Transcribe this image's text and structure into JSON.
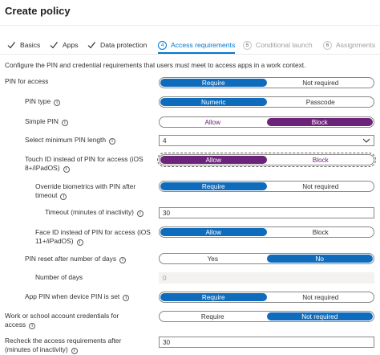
{
  "page": {
    "title": "Create policy"
  },
  "wizard": {
    "steps": [
      {
        "label": "Basics",
        "state": "done"
      },
      {
        "label": "Apps",
        "state": "done"
      },
      {
        "label": "Data protection",
        "state": "done"
      },
      {
        "label": "Access requirements",
        "number": "4",
        "state": "active"
      },
      {
        "label": "Conditional launch",
        "number": "5",
        "state": "pending"
      },
      {
        "label": "Assignments",
        "number": "6",
        "state": "pending"
      }
    ]
  },
  "description": "Configure the PIN and credential requirements that users must meet to access apps in a work context.",
  "settings": {
    "pin_for_access": {
      "label": "PIN for access",
      "options": [
        "Require",
        "Not required"
      ],
      "selected": "Require"
    },
    "pin_type": {
      "label": "PIN type",
      "options": [
        "Numeric",
        "Passcode"
      ],
      "selected": "Numeric"
    },
    "simple_pin": {
      "label": "Simple PIN",
      "options": [
        "Allow",
        "Block"
      ],
      "selected": "Block"
    },
    "min_pin_length": {
      "label": "Select minimum PIN length",
      "value": "4"
    },
    "touch_id": {
      "label_line1": "Touch ID instead of PIN for access (iOS",
      "label_line2": "8+/iPadOS)",
      "options": [
        "Allow",
        "Block"
      ],
      "selected": "Allow"
    },
    "override_biometrics": {
      "label_line1": "Override biometrics with PIN after",
      "label_line2": "timeout",
      "options": [
        "Require",
        "Not required"
      ],
      "selected": "Require"
    },
    "timeout": {
      "label": "Timeout (minutes of inactivity)",
      "value": "30"
    },
    "face_id": {
      "label_line1": "Face ID instead of PIN for access (iOS",
      "label_line2": "11+/iPadOS)",
      "options": [
        "Allow",
        "Block"
      ],
      "selected": "Allow"
    },
    "pin_reset": {
      "label": "PIN reset after number of days",
      "options": [
        "Yes",
        "No"
      ],
      "selected": "No"
    },
    "number_of_days": {
      "label": "Number of days",
      "value": "0"
    },
    "app_pin_device_pin": {
      "label": "App PIN when device PIN is set",
      "options": [
        "Require",
        "Not required"
      ],
      "selected": "Require"
    },
    "work_credentials": {
      "label_line1": "Work or school account credentials for",
      "label_line2": "access",
      "options": [
        "Require",
        "Not required"
      ],
      "selected": "Not required"
    },
    "recheck": {
      "label_line1": "Recheck the access requirements after",
      "label_line2": "(minutes of inactivity)",
      "value": "30"
    }
  },
  "colors": {
    "accent": "#0f6cbd",
    "purple_selected": "#6b2479",
    "border": "#8a8886"
  }
}
